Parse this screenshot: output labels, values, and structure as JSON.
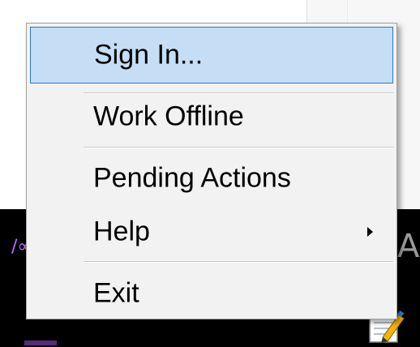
{
  "menu": {
    "items": [
      {
        "label": "Sign In..."
      },
      {
        "label": "Work Offline"
      },
      {
        "label": "Pending Actions"
      },
      {
        "label": "Help"
      },
      {
        "label": "Exit"
      }
    ]
  },
  "background": {
    "glyph_left": "/∞",
    "glyph_right": "A"
  },
  "colors": {
    "highlight_fill": "#c5def5",
    "highlight_border": "#2a78c8",
    "menu_bg": "#f2f2f2"
  },
  "icons": {
    "tray": "notepad-pencil-icon",
    "submenu": "chevron-right-icon"
  }
}
